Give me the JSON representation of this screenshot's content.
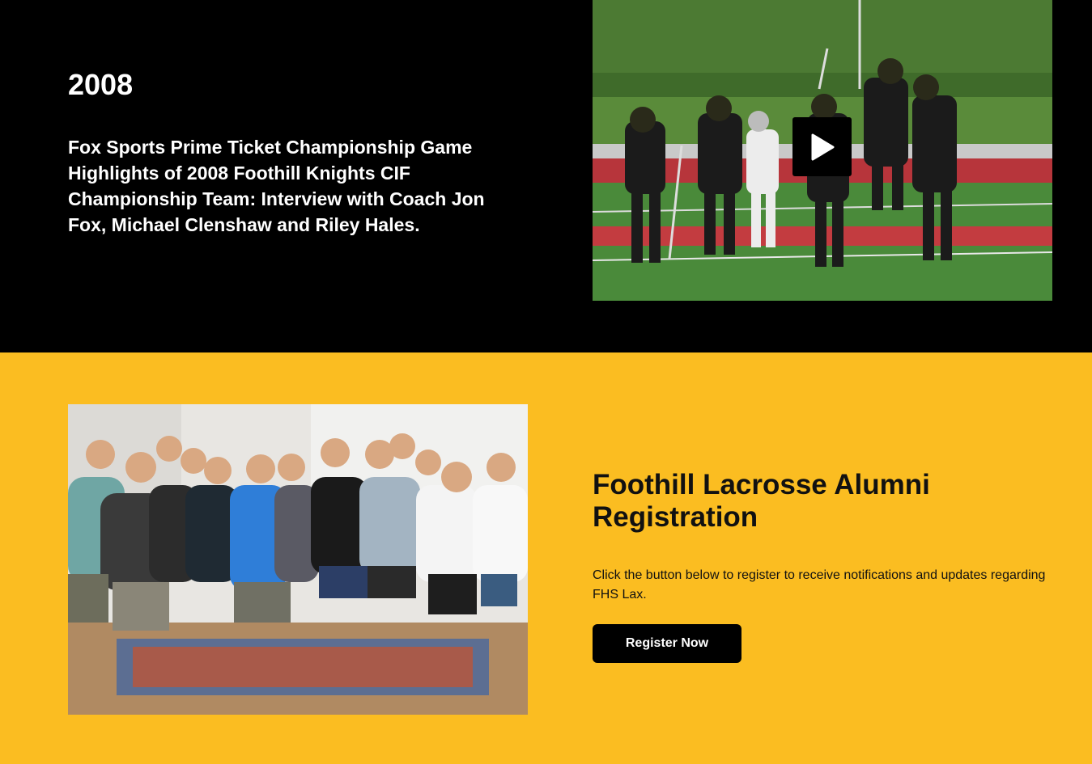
{
  "video_section": {
    "year": "2008",
    "description": "Fox Sports Prime Ticket Championship Game Highlights of 2008 Foothill Knights CIF Championship Team: Interview with Coach Jon Fox, Michael Clenshaw and Riley Hales.",
    "thumbnail_icon": "play-icon"
  },
  "registration_section": {
    "title": "Foothill Lacrosse Alumni Registration",
    "description": "Click the button below to register to receive notifications and updates regarding FHS Lax.",
    "button_label": "Register Now"
  },
  "colors": {
    "dark_background": "#000000",
    "accent_yellow": "#FBBD21",
    "button_background": "#000000",
    "button_text": "#FFFFFF"
  }
}
